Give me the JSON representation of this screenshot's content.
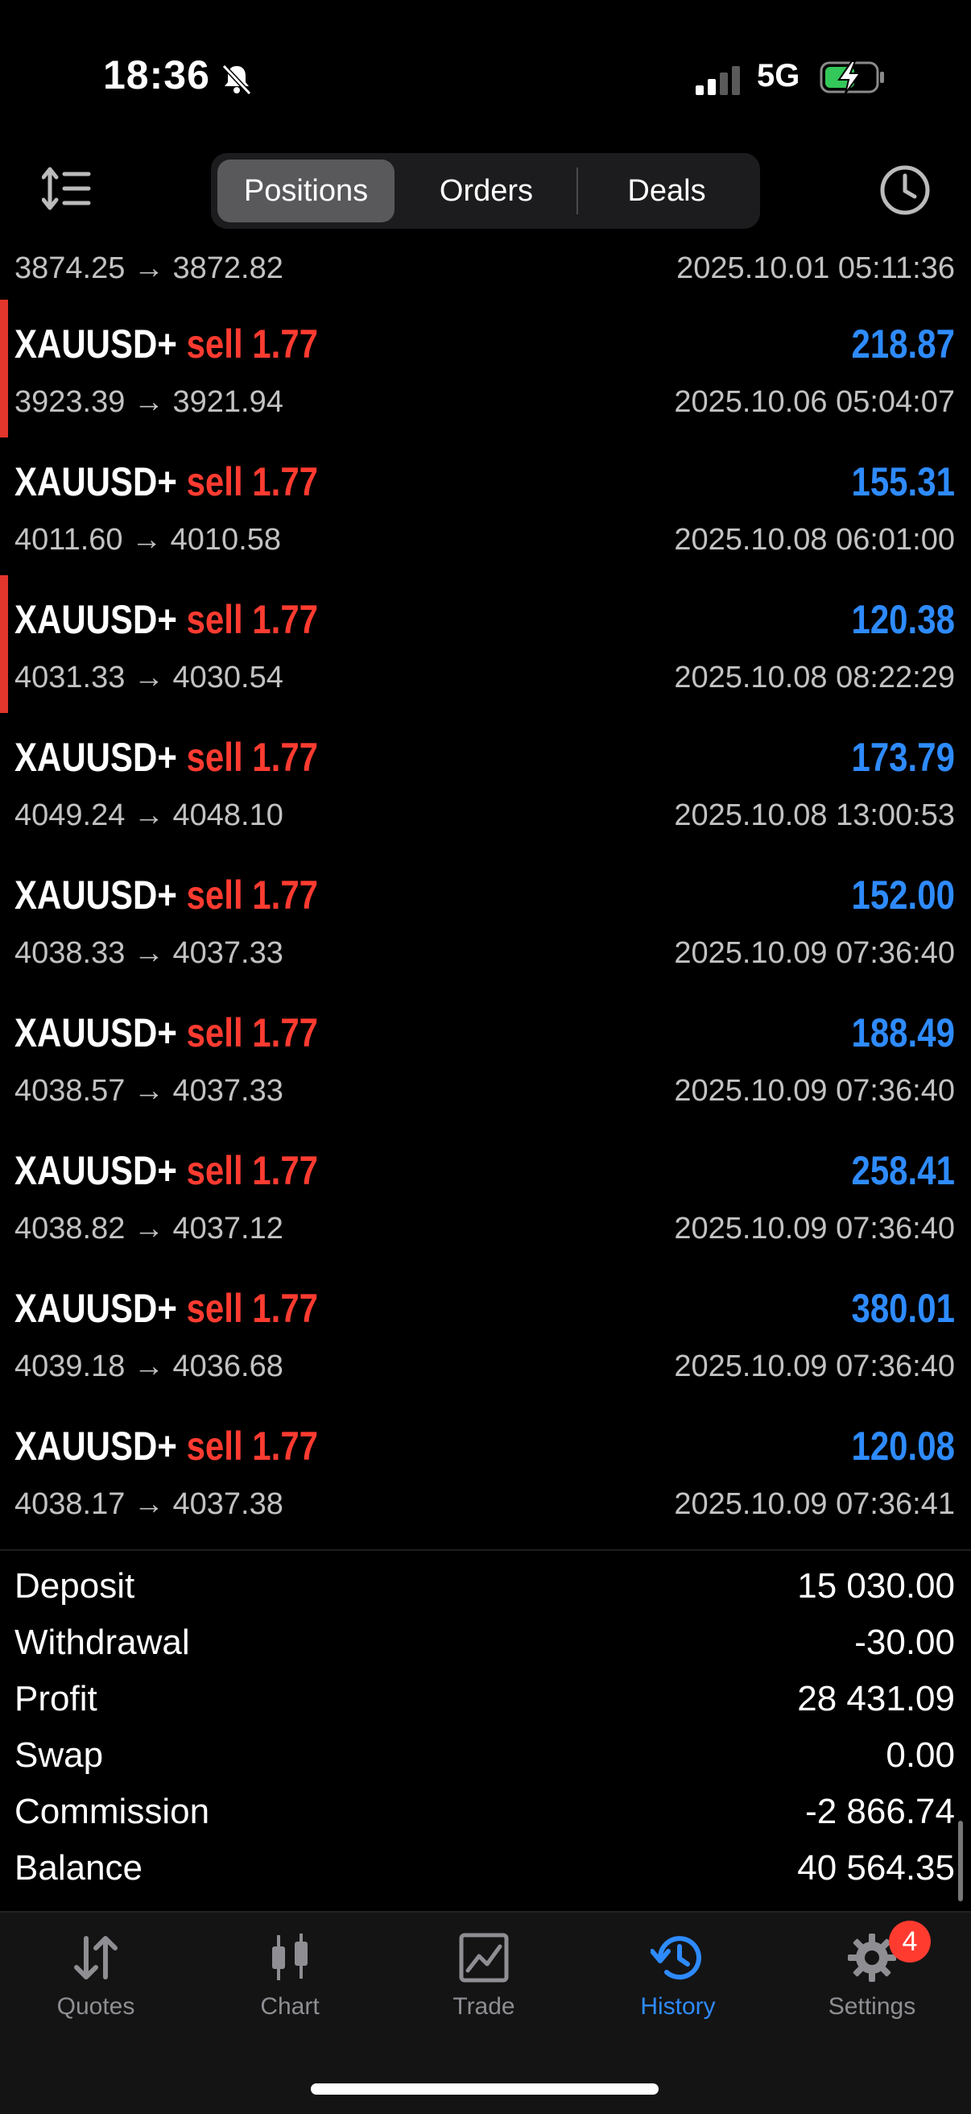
{
  "status_bar": {
    "time": "18:36",
    "network": "5G"
  },
  "header": {
    "tabs": [
      {
        "label": "Positions",
        "selected": true
      },
      {
        "label": "Orders",
        "selected": false
      },
      {
        "label": "Deals",
        "selected": false
      }
    ]
  },
  "partial_row": {
    "prices": "3874.25 → 3872.82",
    "time": "2025.10.01 05:11:36"
  },
  "positions": [
    {
      "symbol": "XAUUSD+",
      "side": "sell 1.77",
      "prices": "3923.39 → 3921.94",
      "profit": "218.87",
      "time": "2025.10.06 05:04:07",
      "marked": true
    },
    {
      "symbol": "XAUUSD+",
      "side": "sell 1.77",
      "prices": "4011.60 → 4010.58",
      "profit": "155.31",
      "time": "2025.10.08 06:01:00",
      "marked": false
    },
    {
      "symbol": "XAUUSD+",
      "side": "sell 1.77",
      "prices": "4031.33 → 4030.54",
      "profit": "120.38",
      "time": "2025.10.08 08:22:29",
      "marked": true
    },
    {
      "symbol": "XAUUSD+",
      "side": "sell 1.77",
      "prices": "4049.24 → 4048.10",
      "profit": "173.79",
      "time": "2025.10.08 13:00:53",
      "marked": false
    },
    {
      "symbol": "XAUUSD+",
      "side": "sell 1.77",
      "prices": "4038.33 → 4037.33",
      "profit": "152.00",
      "time": "2025.10.09 07:36:40",
      "marked": false
    },
    {
      "symbol": "XAUUSD+",
      "side": "sell 1.77",
      "prices": "4038.57 → 4037.33",
      "profit": "188.49",
      "time": "2025.10.09 07:36:40",
      "marked": false
    },
    {
      "symbol": "XAUUSD+",
      "side": "sell 1.77",
      "prices": "4038.82 → 4037.12",
      "profit": "258.41",
      "time": "2025.10.09 07:36:40",
      "marked": false
    },
    {
      "symbol": "XAUUSD+",
      "side": "sell 1.77",
      "prices": "4039.18 → 4036.68",
      "profit": "380.01",
      "time": "2025.10.09 07:36:40",
      "marked": false
    },
    {
      "symbol": "XAUUSD+",
      "side": "sell 1.77",
      "prices": "4038.17 → 4037.38",
      "profit": "120.08",
      "time": "2025.10.09 07:36:41",
      "marked": false
    }
  ],
  "summary": [
    {
      "label": "Deposit",
      "value": "15 030.00"
    },
    {
      "label": "Withdrawal",
      "value": "-30.00"
    },
    {
      "label": "Profit",
      "value": "28 431.09"
    },
    {
      "label": "Swap",
      "value": "0.00"
    },
    {
      "label": "Commission",
      "value": "-2 866.74"
    },
    {
      "label": "Balance",
      "value": "40 564.35"
    }
  ],
  "tabbar": {
    "items": [
      {
        "label": "Quotes",
        "icon": "quotes-arrows-icon"
      },
      {
        "label": "Chart",
        "icon": "candlestick-icon"
      },
      {
        "label": "Trade",
        "icon": "trade-chart-icon"
      },
      {
        "label": "History",
        "icon": "history-clock-icon",
        "active": true
      },
      {
        "label": "Settings",
        "icon": "gear-icon"
      }
    ],
    "settings_badge": "4"
  },
  "colors": {
    "sell": "#ff3b30",
    "profit": "#2e8bff",
    "active_tab": "#2e8bff",
    "marker": "#e2352b"
  }
}
